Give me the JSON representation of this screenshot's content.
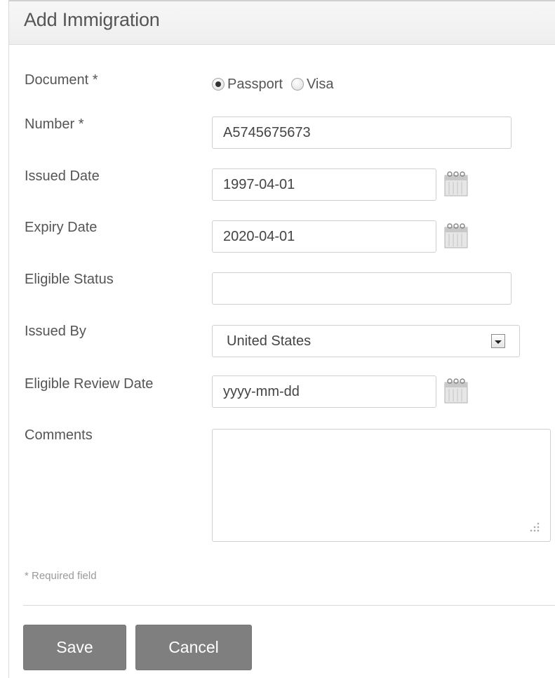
{
  "title": "Add Immigration",
  "document": {
    "label": "Document *",
    "options": [
      {
        "label": "Passport",
        "selected": true
      },
      {
        "label": "Visa",
        "selected": false
      }
    ]
  },
  "number": {
    "label": "Number *",
    "value": "A5745675673"
  },
  "issued_date": {
    "label": "Issued Date",
    "value": "1997-04-01",
    "icon": "calendar-icon"
  },
  "expiry_date": {
    "label": "Expiry Date",
    "value": "2020-04-01",
    "icon": "calendar-icon"
  },
  "eligible_status": {
    "label": "Eligible Status",
    "value": ""
  },
  "issued_by": {
    "label": "Issued By",
    "value": "United States",
    "icon": "dropdown-arrow-icon"
  },
  "eligible_review_date": {
    "label": "Eligible Review Date",
    "value": "",
    "placeholder": "yyyy-mm-dd",
    "icon": "calendar-icon"
  },
  "comments": {
    "label": "Comments",
    "value": ""
  },
  "required_note": "* Required field",
  "buttons": {
    "save": "Save",
    "cancel": "Cancel"
  },
  "colors": {
    "button_bg": "#7f7f7f",
    "header_bg": "#f2f2f2",
    "text": "#555555"
  }
}
